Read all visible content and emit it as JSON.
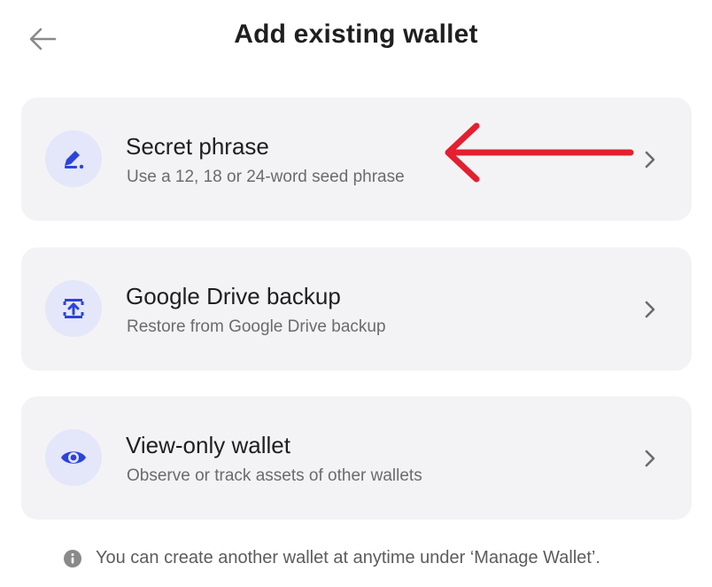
{
  "header": {
    "title": "Add existing wallet",
    "back_icon": "arrow-left-icon"
  },
  "options": [
    {
      "title": "Secret phrase",
      "subtitle": "Use a 12, 18 or 24-word seed phrase",
      "icon": "pen-icon"
    },
    {
      "title": "Google Drive backup",
      "subtitle": "Restore from Google Drive backup",
      "icon": "cloud-restore-icon"
    },
    {
      "title": "View-only wallet",
      "subtitle": "Observe or track assets of other wallets",
      "icon": "eye-icon"
    }
  ],
  "footer": {
    "note": "You can create another wallet at anytime under ‘Manage Wallet’.",
    "icon": "info-icon"
  },
  "annotation": {
    "icon": "red-arrow-pointer",
    "color": "#e3202f"
  },
  "colors": {
    "accent": "#2b44d9",
    "card_bg": "#f3f3f6",
    "icon_bg": "#e4e6fa"
  }
}
